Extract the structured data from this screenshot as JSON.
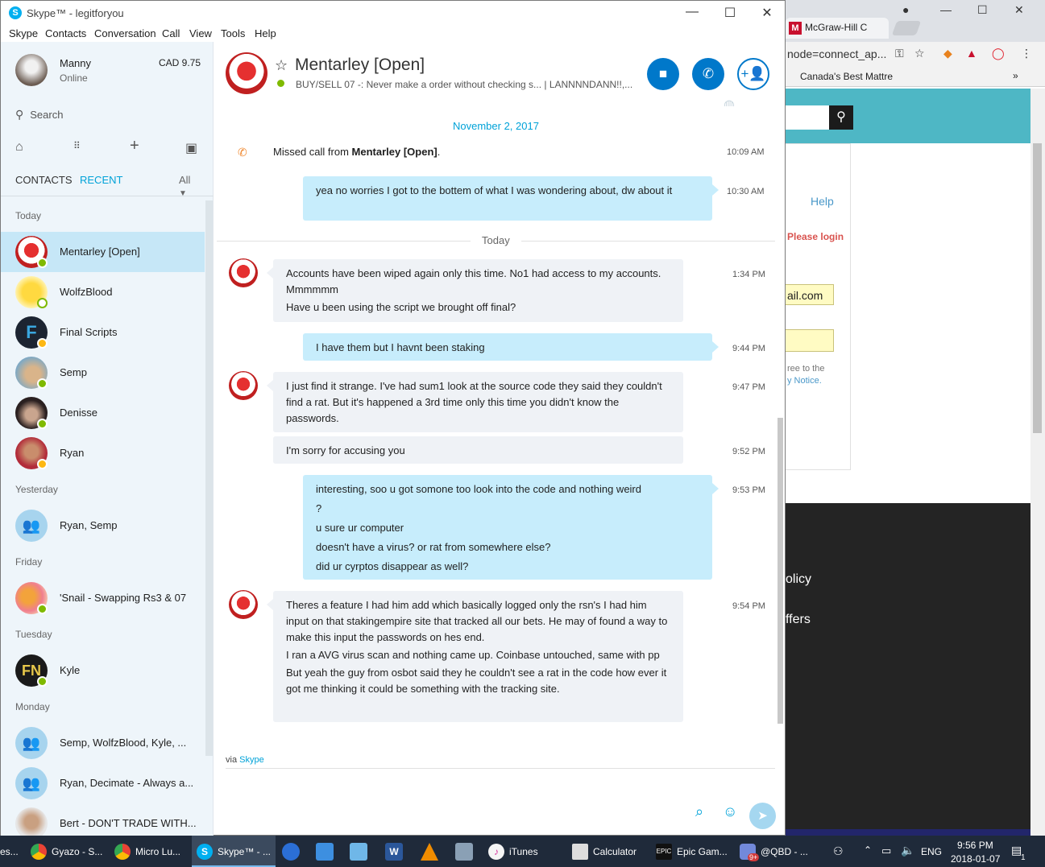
{
  "browser": {
    "tab_title": "McGraw-Hill C",
    "tab_favicon": "M",
    "url": "node=connect_ap...",
    "bookmark": "Canada's Best Mattre",
    "bookmark_more": "»",
    "help": "Help",
    "please_login": "Please login",
    "email_value": "ail.com",
    "agree_line1": "ree to the",
    "agree_line2": "y Notice.",
    "footer_link1": "olicy",
    "footer_link2": "ffers"
  },
  "skype": {
    "window_title": "Skype™ - legitforyou",
    "menu": [
      "Skype",
      "Contacts",
      "Conversation",
      "Call",
      "View",
      "Tools",
      "Help"
    ],
    "me": {
      "name": "Manny",
      "status": "Online",
      "credit": "CAD 9.75"
    },
    "search_placeholder": "Search",
    "tabs": {
      "contacts": "CONTACTS",
      "recent": "RECENT",
      "filter": "All"
    },
    "groups": {
      "today": "Today",
      "yesterday": "Yesterday",
      "friday": "Friday",
      "tuesday": "Tuesday",
      "monday": "Monday"
    },
    "contacts": [
      {
        "name": "Mentarley [Open]",
        "status": "online"
      },
      {
        "name": "WolfzBlood",
        "status": "offline"
      },
      {
        "name": "Final Scripts",
        "status": "away"
      },
      {
        "name": "Semp",
        "status": "online"
      },
      {
        "name": "Denisse",
        "status": "online"
      },
      {
        "name": "Ryan",
        "status": "away"
      },
      {
        "name": "Ryan, Semp",
        "status": "group"
      },
      {
        "name": "'Snail -  Swapping Rs3 & 07",
        "status": "online"
      },
      {
        "name": "Kyle",
        "status": "online"
      },
      {
        "name": "Semp, WolfzBlood, Kyle, ...",
        "status": "group"
      },
      {
        "name": "Ryan, Decimate - Always a...",
        "status": "group"
      },
      {
        "name": "Bert - DON'T TRADE WITH...",
        "status": "none"
      }
    ],
    "conversation": {
      "title": "Mentarley [Open]",
      "mood": "BUY/SELL 07 -: Never make a order without checking s...  |  LANNNNDANN!!,...",
      "date_header": "November 2, 2017",
      "missed_call_prefix": "Missed call from ",
      "missed_call_name": "Mentarley [Open]",
      "missed_call_suffix": ".",
      "missed_call_time": "10:09 AM",
      "today_label": "Today",
      "messages": [
        {
          "dir": "out",
          "time": "10:30 AM",
          "lines": [
            "yea no worries I got to the bottem of what I was wondering about, dw about it"
          ]
        },
        {
          "dir": "in",
          "time": "1:34 PM",
          "lines": [
            "Accounts have been wiped again only this time. No1 had access to my accounts. Mmmmmm",
            "Have u been using the script we brought off final?"
          ]
        },
        {
          "dir": "out",
          "time": "9:44 PM",
          "lines": [
            "I have them but I havnt been staking"
          ]
        },
        {
          "dir": "in",
          "time": "9:47 PM",
          "lines": [
            "I just find it strange. I've had sum1 look at the source code they said they couldn't find a rat. But it's happened a 3rd time only this time you didn't know the passwords."
          ]
        },
        {
          "dir": "in",
          "time": "9:52 PM",
          "lines": [
            "I'm sorry for accusing you"
          ]
        },
        {
          "dir": "out",
          "time": "9:53 PM",
          "lines": [
            "interesting, soo u got somone too look into the code and nothing weird",
            "?",
            "u sure ur computer",
            "doesn't have a virus? or rat from somewhere else?",
            "did ur cyrptos disappear as well?"
          ]
        },
        {
          "dir": "in",
          "time": "9:54 PM",
          "lines": [
            "Theres a feature I had him add which basically logged only the rsn's I had him input on that stakingempire site that tracked all our bets. He may of found a way to make this input the passwords on hes end.",
            "I ran a AVG virus scan and nothing came up. Coinbase untouched, same with pp",
            "But yeah the guy from osbot said they he couldn't see a rat in the code how ever it got me thinking it could be something with the tracking site."
          ]
        }
      ],
      "via_prefix": "via ",
      "via_link": "Skype"
    },
    "colors": {
      "accent": "#00a2d8",
      "call_button": "#0078ca",
      "selected_row": "#c6e7f7",
      "incoming_bubble": "#eff2f6",
      "outgoing_bubble": "#c7edfc"
    }
  },
  "taskbar": {
    "items": [
      "es...",
      "Gyazo - S...",
      "Micro Lu...",
      "Skype™ - ...",
      "iTunes",
      "Calculator",
      "Epic Gam...",
      "@QBD - ..."
    ],
    "badge": "9+",
    "lang": "ENG",
    "time": "9:56 PM",
    "date": "2018-01-07",
    "notifications": "1"
  }
}
